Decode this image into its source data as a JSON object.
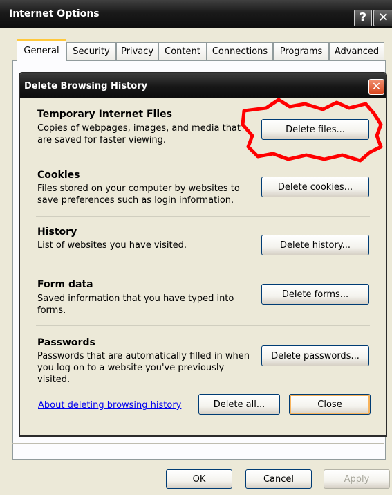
{
  "window": {
    "title": "Internet Options",
    "help_label": "?",
    "close_label": "✕"
  },
  "tabs": [
    {
      "label": "General",
      "active": true
    },
    {
      "label": "Security",
      "active": false
    },
    {
      "label": "Privacy",
      "active": false
    },
    {
      "label": "Content",
      "active": false
    },
    {
      "label": "Connections",
      "active": false
    },
    {
      "label": "Programs",
      "active": false
    },
    {
      "label": "Advanced",
      "active": false
    }
  ],
  "dialog": {
    "title": "Delete Browsing History",
    "close_label": "✕",
    "sections": [
      {
        "title": "Temporary Internet Files",
        "description": "Copies of webpages, images, and media that are saved for faster viewing.",
        "button": "Delete files..."
      },
      {
        "title": "Cookies",
        "description": "Files stored on your computer by websites to save preferences such as login information.",
        "button": "Delete cookies..."
      },
      {
        "title": "History",
        "description": "List of websites you have visited.",
        "button": "Delete history..."
      },
      {
        "title": "Form data",
        "description": "Saved information that you have typed into forms.",
        "button": "Delete forms..."
      },
      {
        "title": "Passwords",
        "description": "Passwords that are automatically filled in when you log on to a website you've previously visited.",
        "button": "Delete passwords..."
      }
    ],
    "about_link": "About deleting browsing history",
    "delete_all": "Delete all...",
    "close": "Close"
  },
  "footer": {
    "ok": "OK",
    "cancel": "Cancel",
    "apply": "Apply"
  },
  "colors": {
    "highlight": "#ff0000",
    "link": "#0000ee",
    "default_button_glow": "#f8b35b"
  }
}
